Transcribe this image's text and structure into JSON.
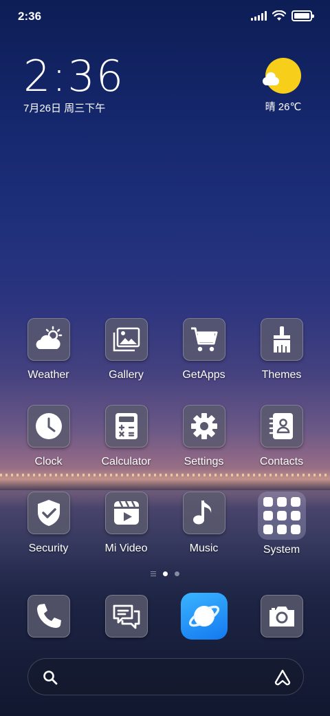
{
  "status_bar": {
    "time": "2:36",
    "icons": [
      "signal-icon",
      "wifi-icon",
      "battery-icon"
    ]
  },
  "clock_widget": {
    "time": "2:36",
    "date": "7月26日 周三下午"
  },
  "weather_widget": {
    "icon": "sunny-cloud-icon",
    "text": "晴 26℃"
  },
  "apps": [
    {
      "label": "Weather",
      "icon": "weather-icon"
    },
    {
      "label": "Gallery",
      "icon": "gallery-icon"
    },
    {
      "label": "GetApps",
      "icon": "cart-icon"
    },
    {
      "label": "Themes",
      "icon": "brush-icon"
    },
    {
      "label": "Clock",
      "icon": "clock-icon"
    },
    {
      "label": "Calculator",
      "icon": "calculator-icon"
    },
    {
      "label": "Settings",
      "icon": "gear-icon"
    },
    {
      "label": "Contacts",
      "icon": "contacts-icon"
    },
    {
      "label": "Security",
      "icon": "shield-check-icon"
    },
    {
      "label": "Mi Video",
      "icon": "video-icon"
    },
    {
      "label": "Music",
      "icon": "music-note-icon"
    },
    {
      "label": "System",
      "icon": "folder-icon"
    }
  ],
  "page_indicator": {
    "pages": 2,
    "current": 1
  },
  "dock": [
    {
      "icon": "phone-icon"
    },
    {
      "icon": "messages-icon"
    },
    {
      "icon": "browser-icon"
    },
    {
      "icon": "camera-icon"
    }
  ],
  "search_bar": {
    "icons": [
      "search-icon",
      "assistant-icon"
    ]
  },
  "colors": {
    "sun": "#f7cf1b",
    "browser": "#1f8ef5",
    "tile": "#5a5a6e"
  }
}
